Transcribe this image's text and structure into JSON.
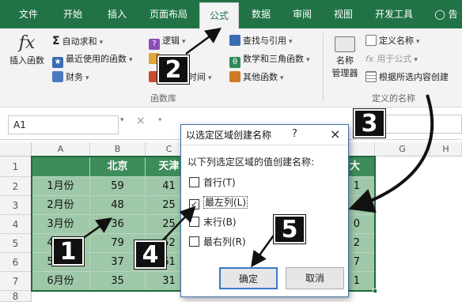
{
  "tabs": [
    "文件",
    "开始",
    "插入",
    "页面布局",
    "公式",
    "数据",
    "审阅",
    "视图",
    "开发工具"
  ],
  "tell_me": "告",
  "ribbon": {
    "insert_function": "插入函数",
    "autosum": "自动求和",
    "recent": "最近使用的函数",
    "financial": "财务",
    "logical": "逻辑",
    "text_partial": "",
    "datetime_partial": "和时间",
    "lookup": "查找与引用",
    "math": "数学和三角函数",
    "other": "其他函数",
    "group_function_library": "函数库",
    "name_manager_line1": "名称",
    "name_manager_line2": "管理器",
    "define_name": "定义名称",
    "use_in_formula": "用于公式",
    "create_from_selection": "根据所选内容创建",
    "group_defined_names": "定义的名称"
  },
  "formula_bar": {
    "name_box": "A1"
  },
  "columns": [
    "A",
    "B",
    "C",
    "D",
    "E",
    "F",
    "G",
    "H"
  ],
  "rows": [
    "1",
    "2",
    "3",
    "4",
    "5",
    "6",
    "7",
    "8"
  ],
  "table": {
    "headers": [
      "",
      "北京",
      "天津",
      "",
      "",
      "大"
    ],
    "body": [
      [
        "1月份",
        "59",
        "41",
        "",
        "",
        "1"
      ],
      [
        "2月份",
        "48",
        "25",
        "",
        "",
        "4"
      ],
      [
        "3月份",
        "36",
        "25",
        "",
        "",
        "0"
      ],
      [
        "4月份",
        "79",
        "52",
        "",
        "",
        "2"
      ],
      [
        "5月份",
        "37",
        "61",
        "",
        "",
        "7"
      ],
      [
        "6月份",
        "35",
        "31",
        "",
        "",
        "1"
      ]
    ]
  },
  "dialog": {
    "title": "以选定区域创建名称",
    "help": "?",
    "close": "×",
    "prompt": "以下列选定区域的值创建名称:",
    "options": [
      {
        "label": "首行(T)",
        "checked": false
      },
      {
        "label": "最左列(L)",
        "checked": true
      },
      {
        "label": "末行(B)",
        "checked": false
      },
      {
        "label": "最右列(R)",
        "checked": false
      }
    ],
    "ok": "确定",
    "cancel": "取消"
  },
  "callouts": [
    "1",
    "2",
    "3",
    "4",
    "5"
  ],
  "colors": {
    "accent": "#217346",
    "header_fill": "#3d8c5a",
    "body_fill": "#9fc8a8"
  }
}
